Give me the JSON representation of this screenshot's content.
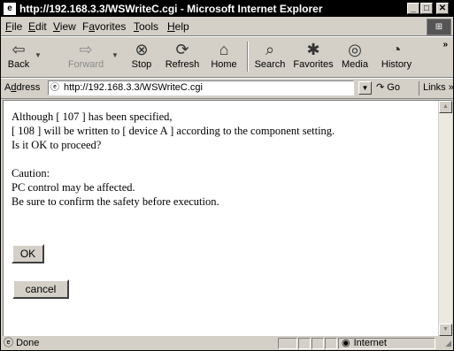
{
  "window": {
    "title": "http://192.168.3.3/WSWriteC.cgi - Microsoft Internet Explorer",
    "minimize": "_",
    "maximize": "□",
    "close": "✕"
  },
  "menu": {
    "items": [
      "File",
      "Edit",
      "View",
      "Favorites",
      "Tools",
      "Help"
    ],
    "underlines": [
      "F",
      "E",
      "V",
      "a",
      "T",
      "H"
    ]
  },
  "toolbar": {
    "buttons": [
      {
        "label": "Back",
        "icon": "back-arrow-icon",
        "glyph": "⇦",
        "enabled": true
      },
      {
        "label": "Forward",
        "icon": "forward-arrow-icon",
        "glyph": "⇨",
        "enabled": false
      },
      {
        "label": "Stop",
        "icon": "stop-icon",
        "glyph": "⊗",
        "enabled": true
      },
      {
        "label": "Refresh",
        "icon": "refresh-icon",
        "glyph": "⟳",
        "enabled": true
      },
      {
        "label": "Home",
        "icon": "home-icon",
        "glyph": "⌂",
        "enabled": true
      },
      {
        "label": "Search",
        "icon": "search-icon",
        "glyph": "⌕",
        "enabled": true
      },
      {
        "label": "Favorites",
        "icon": "favorites-icon",
        "glyph": "✱",
        "enabled": true
      },
      {
        "label": "Media",
        "icon": "media-icon",
        "glyph": "◎",
        "enabled": true
      },
      {
        "label": "History",
        "icon": "history-icon",
        "glyph": "◔",
        "enabled": true
      }
    ],
    "more": "»"
  },
  "address": {
    "label": "Address",
    "label_underline": "d",
    "url": "http://192.168.3.3/WSWriteC.cgi",
    "go_label": "Go",
    "links_label": "Links »"
  },
  "content": {
    "lines": [
      "Although [ 107 ] has been specified,",
      "[ 108 ] will be written to [ device A ] according to the component setting.",
      "Is it OK to proceed?"
    ],
    "caution": [
      "Caution:",
      "PC control may be affected.",
      "Be sure to confirm the safety before execution."
    ],
    "ok_label": "OK",
    "cancel_label": "cancel"
  },
  "status": {
    "text": "Done",
    "zone": "Internet"
  }
}
